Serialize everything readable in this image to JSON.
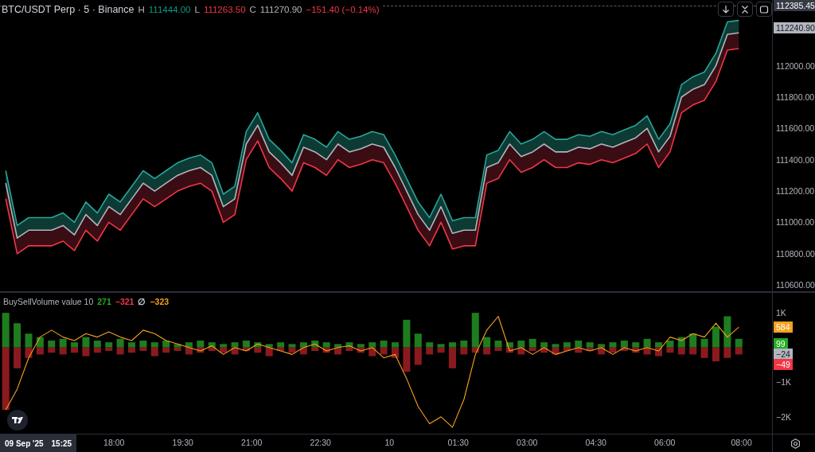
{
  "header": {
    "symbol": "BTC/USDT Perp · 5 · Binance",
    "ohlc": [
      {
        "label": "H",
        "value": "111444.00",
        "kind": "up"
      },
      {
        "label": "L",
        "value": "111263.50",
        "kind": "down"
      },
      {
        "label": "C",
        "value": "111270.90",
        "kind": "neutral"
      }
    ],
    "change": {
      "text": "−151.40 (−0.14%)",
      "kind": "down"
    }
  },
  "price_chart": {
    "chart_data": {
      "type": "line",
      "ylim": [
        110560,
        112420
      ],
      "yticks": [
        {
          "value": 110600,
          "label": "110600.00"
        },
        {
          "value": 110800,
          "label": "110800.00"
        },
        {
          "value": 111000,
          "label": "111000.00"
        },
        {
          "value": 111200,
          "label": "111200.00"
        },
        {
          "value": 111400,
          "label": "111400.00"
        },
        {
          "value": 111600,
          "label": "111600.00"
        },
        {
          "value": 111800,
          "label": "111800.00"
        },
        {
          "value": 112000,
          "label": "112000.00"
        }
      ],
      "series": [
        {
          "color": "#26a69a",
          "values": [
            111330,
            110980,
            111030,
            111030,
            111030,
            111060,
            111000,
            111130,
            111060,
            111180,
            111130,
            111230,
            111330,
            111280,
            111330,
            111380,
            111410,
            111430,
            111380,
            111180,
            111230,
            111580,
            111700,
            111530,
            111460,
            111380,
            111560,
            111530,
            111480,
            111580,
            111530,
            111550,
            111580,
            111560,
            111430,
            111280,
            111130,
            111030,
            111180,
            111010,
            111030,
            111030,
            111430,
            111460,
            111580,
            111500,
            111530,
            111580,
            111530,
            111530,
            111560,
            111550,
            111580,
            111560,
            111590,
            111620,
            111680,
            111530,
            111630,
            111880,
            111930,
            111960,
            112080,
            112280,
            112290
          ]
        },
        {
          "color": "#b2b5be",
          "values": [
            111250,
            110900,
            110950,
            110950,
            110950,
            110980,
            110920,
            111050,
            110980,
            111100,
            111050,
            111150,
            111250,
            111200,
            111250,
            111300,
            111330,
            111350,
            111300,
            111100,
            111150,
            111500,
            111620,
            111450,
            111380,
            111300,
            111480,
            111450,
            111400,
            111500,
            111450,
            111470,
            111500,
            111480,
            111350,
            111200,
            111050,
            110950,
            111100,
            110930,
            110950,
            110950,
            111350,
            111380,
            111500,
            111420,
            111450,
            111500,
            111450,
            111450,
            111480,
            111470,
            111500,
            111480,
            111510,
            111540,
            111600,
            111450,
            111550,
            111800,
            111850,
            111880,
            112000,
            112200,
            112210
          ]
        },
        {
          "color": "#f23645",
          "values": [
            111150,
            110800,
            110850,
            110850,
            110850,
            110880,
            110820,
            110950,
            110880,
            111000,
            110950,
            111050,
            111150,
            111100,
            111150,
            111200,
            111230,
            111250,
            111200,
            111000,
            111050,
            111400,
            111520,
            111350,
            111280,
            111200,
            111380,
            111350,
            111300,
            111400,
            111350,
            111370,
            111400,
            111380,
            111250,
            111100,
            110950,
            110850,
            111000,
            110830,
            110850,
            110850,
            111250,
            111280,
            111400,
            111320,
            111350,
            111400,
            111350,
            111350,
            111380,
            111370,
            111400,
            111380,
            111410,
            111440,
            111500,
            111350,
            111450,
            111700,
            111750,
            111780,
            111900,
            112100,
            112110
          ]
        }
      ]
    },
    "tags": [
      {
        "text": "112385.45",
        "color": "#363a45",
        "kind": "dark"
      },
      {
        "text": "112240.90",
        "color": "#b2b5be",
        "kind": "light"
      }
    ]
  },
  "indicator": {
    "legend": {
      "name": "BuySellVolume value 10",
      "values": [
        {
          "text": "271",
          "color": "#22ab22"
        },
        {
          "text": "−321",
          "color": "#f23645"
        },
        {
          "text": "∅",
          "color": "#d1d4dc"
        },
        {
          "text": "−323",
          "color": "#f7a21b"
        }
      ]
    },
    "chart_data": {
      "type": "bar",
      "stacked": true,
      "ylim": [
        -2510,
        1600
      ],
      "series": [
        {
          "color": "#1e7d1e",
          "values": [
            1000,
            700,
            400,
            300,
            200,
            250,
            150,
            300,
            200,
            150,
            250,
            150,
            200,
            150,
            200,
            100,
            150,
            200,
            150,
            100,
            150,
            200,
            150,
            100,
            150,
            100,
            150,
            200,
            150,
            100,
            150,
            100,
            150,
            200,
            150,
            800,
            400,
            150,
            100,
            150,
            200,
            1000,
            300,
            200,
            150,
            200,
            250,
            150,
            100,
            150,
            200,
            150,
            100,
            150,
            200,
            150,
            250,
            150,
            200,
            300,
            400,
            250,
            600,
            900,
            250
          ]
        },
        {
          "color": "#8b1a1f",
          "values": [
            -1800,
            -600,
            -300,
            -200,
            -150,
            -200,
            -150,
            -250,
            -150,
            -100,
            -200,
            -150,
            -100,
            -250,
            -150,
            -100,
            -200,
            -150,
            -100,
            -150,
            -200,
            -100,
            -150,
            -250,
            -100,
            -150,
            -200,
            -100,
            -150,
            -200,
            -100,
            -150,
            -250,
            -200,
            -300,
            -700,
            -500,
            -200,
            -150,
            -600,
            -200,
            -150,
            -200,
            -100,
            -150,
            -200,
            -100,
            -150,
            -200,
            -100,
            -150,
            -100,
            -200,
            -150,
            -100,
            -150,
            -200,
            -250,
            -150,
            -200,
            -200,
            -300,
            -400,
            -300,
            -200
          ]
        }
      ]
    },
    "tags": [
      {
        "text": "584",
        "color": "#f7a21b"
      },
      {
        "text": "99",
        "color": "#22ab22"
      },
      {
        "text": "−24",
        "color": "#b2b5be"
      },
      {
        "text": "−49",
        "color": "#f23645"
      }
    ]
  },
  "delta_line": {
    "chart_data": {
      "type": "line",
      "ylim": [
        -2510,
        1600
      ],
      "yticks": [
        {
          "value": 1000,
          "label": "1K"
        },
        {
          "value": -1000,
          "label": "−1K"
        },
        {
          "value": -2000,
          "label": "−2K"
        }
      ],
      "series": [
        {
          "color": "#f7a21b",
          "values": [
            -1800,
            -1200,
            -300,
            300,
            500,
            300,
            200,
            400,
            300,
            450,
            300,
            200,
            500,
            400,
            200,
            100,
            0,
            -100,
            50,
            -200,
            0,
            -100,
            100,
            0,
            -100,
            -200,
            0,
            100,
            -100,
            0,
            50,
            -100,
            0,
            -300,
            -200,
            -900,
            -1700,
            -2200,
            -2000,
            -2300,
            -1500,
            -200,
            500,
            900,
            -100,
            0,
            -200,
            0,
            -200,
            -100,
            0,
            -100,
            0,
            -200,
            0,
            -100,
            0,
            -100,
            300,
            200,
            400,
            300,
            700,
            300,
            584
          ]
        }
      ]
    }
  },
  "time_axis": {
    "date": "09 Sep '25",
    "time": "15:25",
    "labels": [
      "18:00",
      "19:30",
      "21:00",
      "22:30",
      "10",
      "01:30",
      "03:00",
      "04:30",
      "06:00",
      "08:00"
    ]
  }
}
